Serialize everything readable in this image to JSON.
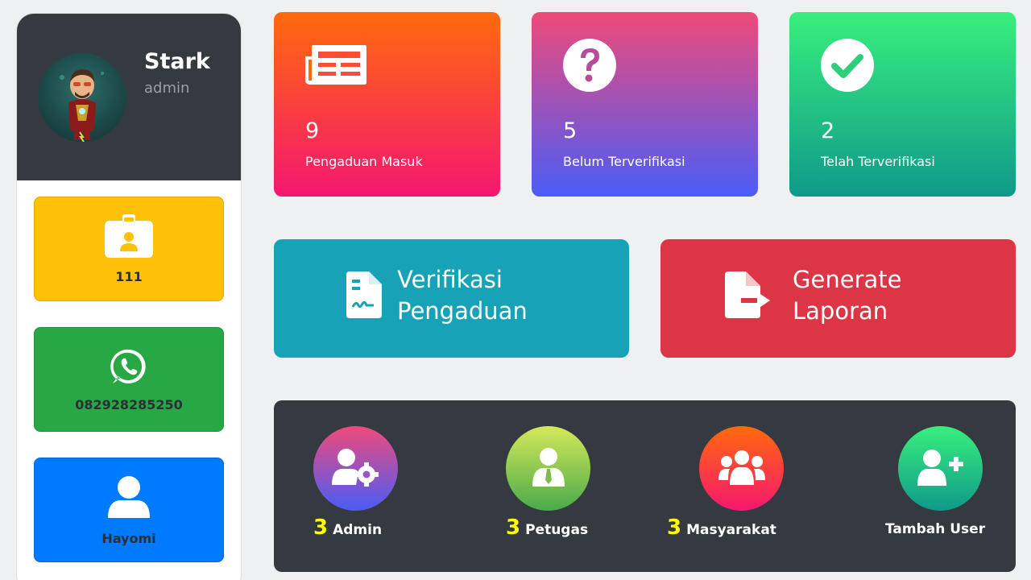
{
  "profile": {
    "name": "Stark",
    "role": "admin",
    "boxes": [
      {
        "label": "111",
        "icon": "id-card-icon"
      },
      {
        "label": "082928285250",
        "icon": "whatsapp-icon"
      },
      {
        "label": "Hayomi",
        "icon": "user-icon"
      }
    ]
  },
  "stats": [
    {
      "value": "9",
      "label": "Pengaduan Masuk",
      "icon": "newspaper-icon"
    },
    {
      "value": "5",
      "label": "Belum Terverifikasi",
      "icon": "question-circle-icon"
    },
    {
      "value": "2",
      "label": "Telah Terverifikasi",
      "icon": "check-circle-icon"
    }
  ],
  "actions": {
    "verify": {
      "line1": "Verifikasi",
      "line2": "Pengaduan",
      "icon": "signed-document-icon"
    },
    "report": {
      "line1": "Generate",
      "line2": "Laporan",
      "icon": "file-export-icon"
    }
  },
  "users": [
    {
      "count": "3",
      "label": "Admin",
      "icon": "user-gear-icon"
    },
    {
      "count": "3",
      "label": "Petugas",
      "icon": "user-tie-icon"
    },
    {
      "count": "3",
      "label": "Masyarakat",
      "icon": "users-group-icon"
    },
    {
      "count": "",
      "label": "Tambah User",
      "icon": "user-plus-icon"
    }
  ],
  "colors": {
    "sidebar_header": "#353a41",
    "yellow": "#ffc107",
    "green": "#28a745",
    "blue": "#007bff",
    "teal": "#17a2b8",
    "red": "#dc3545",
    "count_yellow": "#ffff00"
  }
}
